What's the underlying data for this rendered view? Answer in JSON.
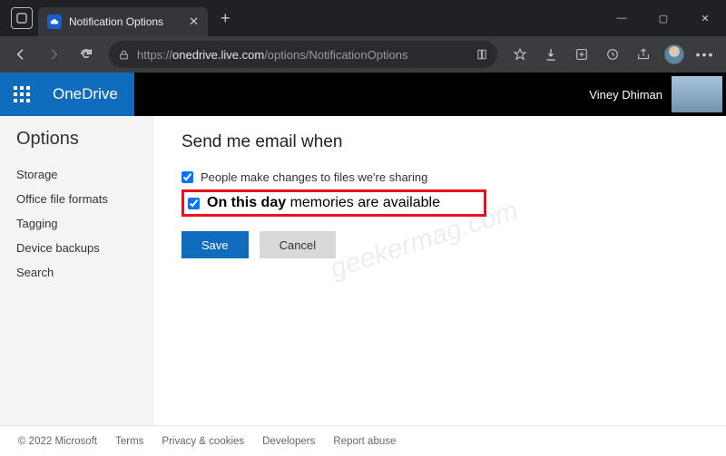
{
  "browser": {
    "tab_title": "Notification Options",
    "url_proto": "https://",
    "url_host": "onedrive.live.com",
    "url_path": "/options/NotificationOptions"
  },
  "win": {
    "min": "—",
    "max": "▢",
    "close": "✕"
  },
  "header": {
    "brand": "OneDrive",
    "username": "Viney Dhiman"
  },
  "sidebar": {
    "title": "Options",
    "items": [
      "Storage",
      "Office file formats",
      "Tagging",
      "Device backups",
      "Search"
    ]
  },
  "main": {
    "heading": "Send me email when",
    "option1": "People make changes to files we're sharing",
    "option2_bold": "On this day",
    "option2_rest": " memories are available",
    "save": "Save",
    "cancel": "Cancel"
  },
  "footer": {
    "copyright": "© 2022 Microsoft",
    "links": [
      "Terms",
      "Privacy & cookies",
      "Developers",
      "Report abuse"
    ]
  },
  "watermark": "geekermag.com"
}
